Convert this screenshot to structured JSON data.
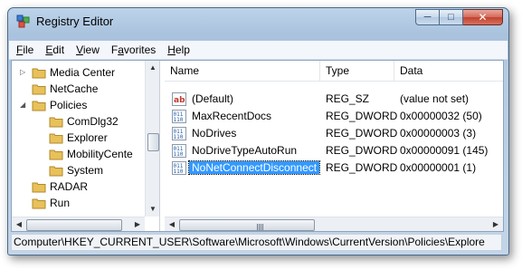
{
  "window": {
    "title": "Registry Editor"
  },
  "caption": {
    "minimize": "─",
    "maximize": "□",
    "close": "✕"
  },
  "menu": [
    {
      "label_u": "F",
      "label_rest": "ile"
    },
    {
      "label_u": "E",
      "label_rest": "dit"
    },
    {
      "label_u": "V",
      "label_rest": "iew"
    },
    {
      "label_pre": "F",
      "label_u": "a",
      "label_rest": "vorites"
    },
    {
      "label_u": "H",
      "label_rest": "elp"
    }
  ],
  "tree": {
    "items": [
      {
        "label": "Media Center",
        "expander": "▷"
      },
      {
        "label": "NetCache",
        "expander": ""
      },
      {
        "label": "Policies",
        "expander": "◢"
      },
      {
        "label": "ComDlg32",
        "expander": ""
      },
      {
        "label": "Explorer",
        "expander": ""
      },
      {
        "label": "MobilityCente",
        "expander": ""
      },
      {
        "label": "System",
        "expander": ""
      },
      {
        "label": "RADAR",
        "expander": ""
      },
      {
        "label": "Run",
        "expander": ""
      }
    ]
  },
  "list": {
    "headers": {
      "name": "Name",
      "type": "Type",
      "data": "Data"
    },
    "rows": [
      {
        "name": "(Default)",
        "type": "REG_SZ",
        "data": "(value not set)",
        "icon": "string-value-icon"
      },
      {
        "name": "MaxRecentDocs",
        "type": "REG_DWORD",
        "data": "0x00000032 (50)",
        "icon": "dword-value-icon"
      },
      {
        "name": "NoDrives",
        "type": "REG_DWORD",
        "data": "0x00000003 (3)",
        "icon": "dword-value-icon"
      },
      {
        "name": "NoDriveTypeAutoRun",
        "type": "REG_DWORD",
        "data": "0x00000091 (145)",
        "icon": "dword-value-icon"
      },
      {
        "name": "NoNetConnectDisconnect",
        "type": "REG_DWORD",
        "data": "0x00000001 (1)",
        "icon": "dword-value-icon",
        "selected": true
      }
    ]
  },
  "scroll": {
    "up": "▲",
    "down": "▼",
    "left": "◀",
    "right": "▶"
  },
  "status": {
    "path": "Computer\\HKEY_CURRENT_USER\\Software\\Microsoft\\Windows\\CurrentVersion\\Policies\\Explore"
  },
  "colors": {
    "selection": "#3399ff",
    "folder": "#e8c15a",
    "close_button": "#c0432f"
  }
}
